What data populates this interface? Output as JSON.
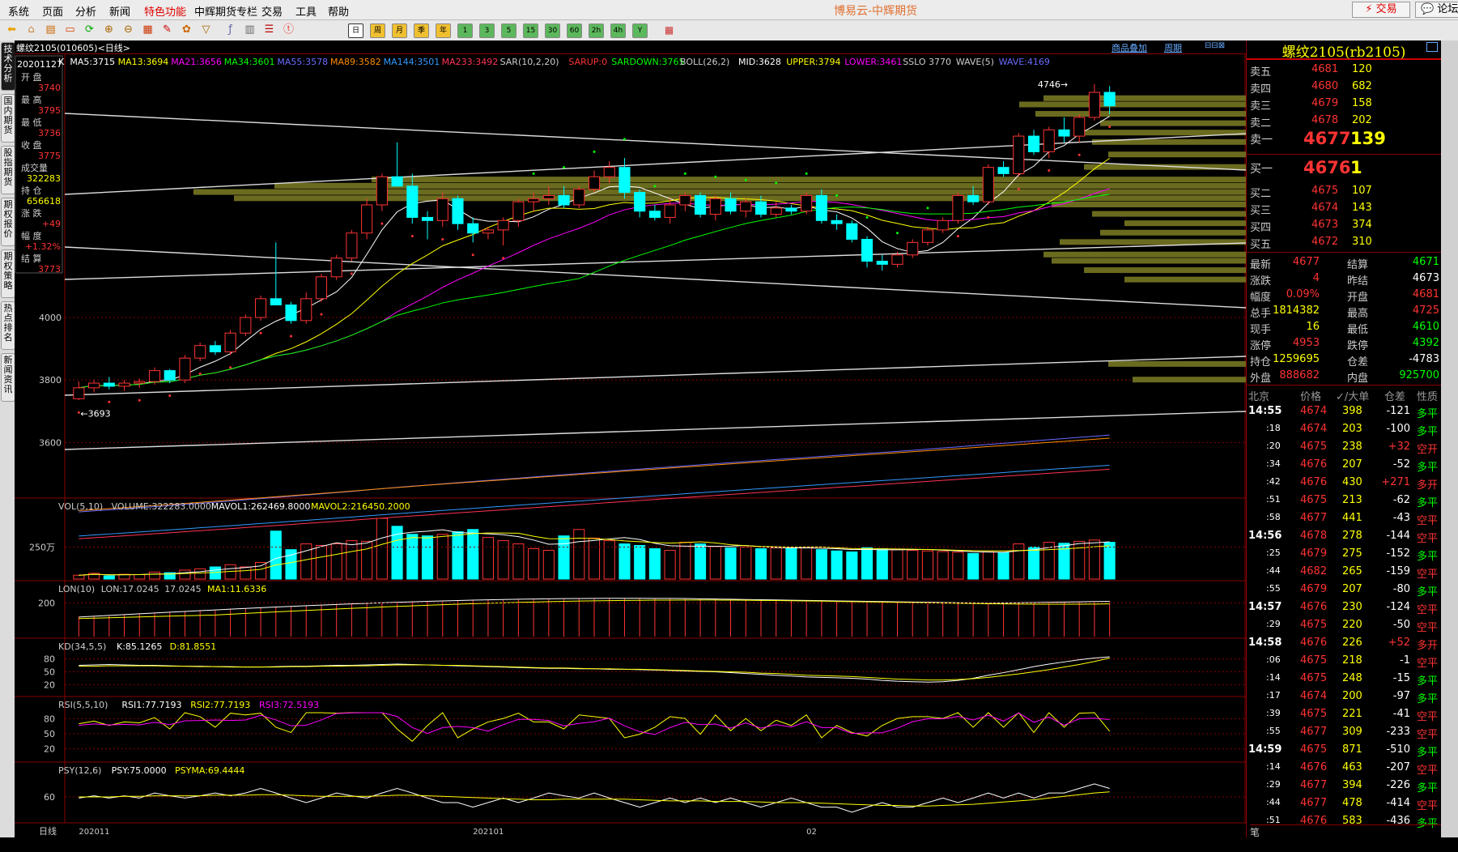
{
  "menu": [
    "系统",
    "页面",
    "分析",
    "新闻",
    "特色功能",
    "中辉期货专栏",
    "交易",
    "工具",
    "帮助"
  ],
  "menu_highlight_index": 4,
  "app_title": "博易云-中辉期货",
  "trade_button": "⚡ 交易",
  "forum_button": "💬 论坛",
  "toolbar": {
    "periods": [
      "日",
      "周",
      "月",
      "季",
      "年",
      "1",
      "3",
      "5",
      "15",
      "30",
      "60",
      "2h",
      "4h",
      "Y"
    ],
    "active_period": "日"
  },
  "left_tabs": [
    {
      "label": "技术分析",
      "active": true
    },
    {
      "label": "国内期货",
      "active": false
    },
    {
      "label": "股指期货",
      "active": false
    },
    {
      "label": "期权报价",
      "active": false
    },
    {
      "label": "期权策略",
      "active": false
    },
    {
      "label": "热点排名",
      "active": false
    },
    {
      "label": "新闻资讯",
      "active": false
    }
  ],
  "chart_header": {
    "symbol": "螺纹2105(010605)<日线>",
    "overlay": "商品叠加",
    "period": "周期"
  },
  "info_box": {
    "date": "20201127",
    "fields": [
      {
        "label": "开  盘",
        "value": "3740"
      },
      {
        "label": "最  高",
        "value": "3795"
      },
      {
        "label": "最  低",
        "value": "3736"
      },
      {
        "label": "收  盘",
        "value": "3775"
      },
      {
        "label": "成交量",
        "value": "322283"
      },
      {
        "label": "持  仓",
        "value": "656618"
      },
      {
        "label": "涨  跌",
        "value": "+49"
      },
      {
        "label": "幅  度",
        "value": "+1.32%"
      },
      {
        "label": "结  算",
        "value": "3773"
      }
    ]
  },
  "ma_legend": [
    {
      "text": "K",
      "color": "#ffffff"
    },
    {
      "text": "MA5:3715",
      "color": "#ffffff"
    },
    {
      "text": "MA13:3694",
      "color": "#ffff00"
    },
    {
      "text": "MA21:3656",
      "color": "#ff00ff"
    },
    {
      "text": "MA34:3601",
      "color": "#00ff00"
    },
    {
      "text": "MA55:3578",
      "color": "#6a6aff"
    },
    {
      "text": "MA89:3582",
      "color": "#ff8c00"
    },
    {
      "text": "MA144:3501",
      "color": "#3399ff"
    },
    {
      "text": "MA233:3492",
      "color": "#ff3355"
    },
    {
      "text": "SAR(10,2,20)",
      "color": "#cccccc"
    },
    {
      "text": "SARUP:0",
      "color": "#ff3333"
    },
    {
      "text": "SARDOWN:3765",
      "color": "#00ff00"
    },
    {
      "text": "BOLL(26,2)",
      "color": "#cccccc"
    },
    {
      "text": "MID:3628",
      "color": "#ffffff"
    },
    {
      "text": "UPPER:3794",
      "color": "#ffff00"
    },
    {
      "text": "LOWER:3461",
      "color": "#ff00ff"
    },
    {
      "text": "SSLO 3770",
      "color": "#cccccc"
    },
    {
      "text": "WAVE(5)",
      "color": "#cccccc"
    },
    {
      "text": "WAVE:4169",
      "color": "#6a6aff"
    }
  ],
  "indicators": {
    "vol": [
      {
        "text": "VOL(5,10)",
        "color": "#cccccc"
      },
      {
        "text": "VOLUME:322283.0000",
        "color": "#cccccc"
      },
      {
        "text": "MAVOL1:262469.8000",
        "color": "#ffffff"
      },
      {
        "text": "MAVOL2:216450.2000",
        "color": "#ffff00"
      }
    ],
    "lon": [
      {
        "text": "LON(10)",
        "color": "#cccccc"
      },
      {
        "text": "LON:17.0245",
        "color": "#cccccc"
      },
      {
        "text": "17.0245",
        "color": "#cccccc"
      },
      {
        "text": "MA1:11.6336",
        "color": "#ffff00"
      }
    ],
    "kd": [
      {
        "text": "KD(34,5,5)",
        "color": "#cccccc"
      },
      {
        "text": "K:85.1265",
        "color": "#ffffff"
      },
      {
        "text": "D:81.8551",
        "color": "#ffff00"
      }
    ],
    "rsi": [
      {
        "text": "RSI(5,5,10)",
        "color": "#cccccc"
      },
      {
        "text": "RSI1:77.7193",
        "color": "#ffffff"
      },
      {
        "text": "RSI2:77.7193",
        "color": "#ffff00"
      },
      {
        "text": "RSI3:72.5193",
        "color": "#ff00ff"
      }
    ],
    "psy": [
      {
        "text": "PSY(12,6)",
        "color": "#cccccc"
      },
      {
        "text": "PSY:75.0000",
        "color": "#ffffff"
      },
      {
        "text": "PSYMA:69.4444",
        "color": "#ffff00"
      }
    ]
  },
  "y_ticks": {
    "main": [
      "4000",
      "3800",
      "3600"
    ],
    "vol": [
      "250万"
    ],
    "lon": [
      "200"
    ],
    "kd": [
      "80",
      "50",
      "20"
    ],
    "rsi": [
      "80",
      "50",
      "20"
    ],
    "psy": [
      "60"
    ]
  },
  "annotations": {
    "high": "4746→",
    "low": "←3693"
  },
  "x_labels": [
    "日线",
    "202011",
    "202101",
    "02"
  ],
  "chart_data": {
    "type": "candlestick",
    "title": "螺纹2105(010605)<日线>",
    "period": "日线",
    "y_range": [
      3500,
      4790
    ],
    "candles": [
      [
        3740,
        3795,
        3736,
        3775
      ],
      [
        3775,
        3800,
        3760,
        3790
      ],
      [
        3790,
        3810,
        3770,
        3780
      ],
      [
        3780,
        3800,
        3765,
        3790
      ],
      [
        3790,
        3805,
        3775,
        3795
      ],
      [
        3795,
        3840,
        3785,
        3830
      ],
      [
        3830,
        3835,
        3790,
        3800
      ],
      [
        3800,
        3880,
        3790,
        3870
      ],
      [
        3870,
        3920,
        3860,
        3910
      ],
      [
        3910,
        3925,
        3880,
        3890
      ],
      [
        3890,
        3960,
        3880,
        3950
      ],
      [
        3950,
        4010,
        3940,
        4000
      ],
      [
        4000,
        4070,
        3990,
        4060
      ],
      [
        4060,
        4240,
        4040,
        4040
      ],
      [
        4040,
        4050,
        3980,
        3990
      ],
      [
        3990,
        4080,
        3980,
        4060
      ],
      [
        4060,
        4140,
        4050,
        4130
      ],
      [
        4130,
        4200,
        4120,
        4190
      ],
      [
        4190,
        4280,
        4180,
        4270
      ],
      [
        4270,
        4380,
        4250,
        4360
      ],
      [
        4360,
        4460,
        4340,
        4450
      ],
      [
        4450,
        4560,
        4420,
        4420
      ],
      [
        4420,
        4460,
        4300,
        4320
      ],
      [
        4320,
        4340,
        4250,
        4310
      ],
      [
        4310,
        4400,
        4290,
        4380
      ],
      [
        4380,
        4390,
        4280,
        4300
      ],
      [
        4300,
        4320,
        4240,
        4270
      ],
      [
        4270,
        4290,
        4250,
        4280
      ],
      [
        4280,
        4320,
        4230,
        4310
      ],
      [
        4310,
        4380,
        4290,
        4370
      ],
      [
        4370,
        4400,
        4340,
        4380
      ],
      [
        4380,
        4420,
        4360,
        4390
      ],
      [
        4390,
        4420,
        4350,
        4360
      ],
      [
        4360,
        4420,
        4350,
        4410
      ],
      [
        4410,
        4470,
        4400,
        4450
      ],
      [
        4450,
        4500,
        4430,
        4480
      ],
      [
        4480,
        4510,
        4380,
        4400
      ],
      [
        4400,
        4410,
        4320,
        4340
      ],
      [
        4340,
        4360,
        4310,
        4320
      ],
      [
        4320,
        4380,
        4300,
        4360
      ],
      [
        4360,
        4400,
        4340,
        4390
      ],
      [
        4390,
        4400,
        4320,
        4330
      ],
      [
        4330,
        4390,
        4310,
        4380
      ],
      [
        4380,
        4400,
        4330,
        4340
      ],
      [
        4340,
        4380,
        4320,
        4370
      ],
      [
        4370,
        4390,
        4320,
        4330
      ],
      [
        4330,
        4370,
        4320,
        4350
      ],
      [
        4350,
        4360,
        4330,
        4340
      ],
      [
        4340,
        4400,
        4330,
        4390
      ],
      [
        4390,
        4410,
        4300,
        4310
      ],
      [
        4310,
        4330,
        4280,
        4300
      ],
      [
        4300,
        4310,
        4240,
        4250
      ],
      [
        4250,
        4260,
        4160,
        4180
      ],
      [
        4180,
        4200,
        4150,
        4170
      ],
      [
        4170,
        4210,
        4160,
        4200
      ],
      [
        4200,
        4250,
        4190,
        4240
      ],
      [
        4240,
        4290,
        4230,
        4280
      ],
      [
        4280,
        4320,
        4270,
        4310
      ],
      [
        4310,
        4400,
        4300,
        4390
      ],
      [
        4390,
        4420,
        4360,
        4370
      ],
      [
        4370,
        4490,
        4360,
        4480
      ],
      [
        4480,
        4500,
        4450,
        4460
      ],
      [
        4460,
        4590,
        4450,
        4580
      ],
      [
        4580,
        4600,
        4520,
        4530
      ],
      [
        4530,
        4610,
        4510,
        4600
      ],
      [
        4600,
        4640,
        4560,
        4580
      ],
      [
        4580,
        4650,
        4560,
        4640
      ],
      [
        4640,
        4746,
        4630,
        4720
      ],
      [
        4720,
        4740,
        4650,
        4677
      ]
    ],
    "volume_wan": [
      12,
      18,
      10,
      15,
      14,
      22,
      20,
      28,
      32,
      38,
      45,
      38,
      52,
      150,
      92,
      110,
      105,
      110,
      120,
      118,
      190,
      165,
      140,
      135,
      140,
      148,
      155,
      130,
      120,
      110,
      95,
      90,
      135,
      155,
      128,
      120,
      110,
      105,
      95,
      90,
      115,
      110,
      102,
      98,
      100,
      95,
      98,
      96,
      100,
      92,
      88,
      85,
      98,
      95,
      92,
      90,
      88,
      86,
      84,
      80,
      85,
      83,
      110,
      100,
      115,
      112,
      118,
      122,
      115
    ],
    "kd_k": [
      65,
      66,
      67,
      66,
      65,
      65,
      64,
      63,
      63,
      62,
      62,
      61,
      61,
      62,
      63,
      63,
      64,
      65,
      65,
      66,
      67,
      68,
      67,
      66,
      65,
      64,
      63,
      62,
      61,
      60,
      59,
      58,
      58,
      57,
      57,
      56,
      56,
      55,
      54,
      53,
      52,
      51,
      50,
      48,
      46,
      44,
      42,
      40,
      38,
      37,
      36,
      35,
      33,
      30,
      28,
      27,
      26,
      27,
      30,
      35,
      42,
      48,
      55,
      62,
      68,
      73,
      78,
      82,
      85
    ],
    "kd_d": [
      63,
      63,
      64,
      64,
      64,
      64,
      63,
      63,
      62,
      62,
      61,
      61,
      61,
      61,
      62,
      62,
      63,
      63,
      64,
      64,
      65,
      66,
      66,
      66,
      65,
      65,
      64,
      63,
      62,
      61,
      60,
      59,
      59,
      58,
      57,
      57,
      56,
      56,
      55,
      54,
      53,
      52,
      51,
      50,
      49,
      47,
      46,
      44,
      42,
      41,
      40,
      39,
      37,
      35,
      33,
      32,
      31,
      31,
      32,
      34,
      37,
      41,
      45,
      50,
      55,
      61,
      67,
      74,
      82
    ],
    "psy": [
      58,
      62,
      58,
      62,
      58,
      67,
      62,
      58,
      62,
      67,
      62,
      67,
      75,
      67,
      58,
      50,
      58,
      67,
      62,
      58,
      67,
      75,
      67,
      58,
      50,
      50,
      42,
      50,
      58,
      50,
      58,
      67,
      62,
      58,
      67,
      58,
      50,
      42,
      50,
      58,
      50,
      58,
      50,
      58,
      50,
      42,
      50,
      58,
      50,
      42,
      42,
      33,
      42,
      50,
      42,
      42,
      50,
      58,
      50,
      58,
      67,
      58,
      67,
      58,
      67,
      67,
      75,
      83,
      75
    ],
    "psy_ma": [
      60,
      60,
      60,
      61,
      61,
      62,
      62,
      62,
      62,
      63,
      63,
      63,
      64,
      64,
      63,
      62,
      61,
      61,
      61,
      61,
      62,
      63,
      63,
      62,
      61,
      60,
      59,
      58,
      57,
      56,
      55,
      55,
      56,
      56,
      56,
      56,
      56,
      55,
      54,
      53,
      53,
      53,
      52,
      52,
      52,
      51,
      50,
      50,
      50,
      49,
      48,
      47,
      46,
      45,
      45,
      44,
      44,
      45,
      46,
      47,
      49,
      51,
      53,
      55,
      58,
      61,
      64,
      67,
      69
    ],
    "ma5_last": 3715,
    "ma13_last": 3694,
    "ma21_last": 3656,
    "ma34_last": 3601,
    "ma55_last": 3578,
    "ma89_last": 3582,
    "ma144_last": 3501,
    "ma233_last": 3492
  },
  "quote": {
    "title": "螺纹2105(rb2105)",
    "asks": [
      {
        "label": "卖五",
        "price": "4681",
        "vol": "120"
      },
      {
        "label": "卖四",
        "price": "4680",
        "vol": "682"
      },
      {
        "label": "卖三",
        "price": "4679",
        "vol": "158"
      },
      {
        "label": "卖二",
        "price": "4678",
        "vol": "202"
      },
      {
        "label": "卖一",
        "price": "4677",
        "vol": "139"
      }
    ],
    "bids": [
      {
        "label": "买一",
        "price": "4676",
        "vol": "1"
      },
      {
        "label": "买二",
        "price": "4675",
        "vol": "107"
      },
      {
        "label": "买三",
        "price": "4674",
        "vol": "143"
      },
      {
        "label": "买四",
        "price": "4673",
        "vol": "374"
      },
      {
        "label": "买五",
        "price": "4672",
        "vol": "310"
      }
    ],
    "stats": [
      {
        "l1": "最新",
        "v1": "4677",
        "c1": "#ff3333",
        "l2": "结算",
        "v2": "4671",
        "c2": "#00ff00"
      },
      {
        "l1": "涨跌",
        "v1": "4",
        "c1": "#ff3333",
        "l2": "昨结",
        "v2": "4673",
        "c2": "#ffffff"
      },
      {
        "l1": "幅度",
        "v1": "0.09%",
        "c1": "#ff3333",
        "l2": "开盘",
        "v2": "4681",
        "c2": "#ff3333"
      },
      {
        "l1": "总手",
        "v1": "1814382",
        "c1": "#ffff00",
        "l2": "最高",
        "v2": "4725",
        "c2": "#ff3333"
      },
      {
        "l1": "现手",
        "v1": "16",
        "c1": "#ffff00",
        "l2": "最低",
        "v2": "4610",
        "c2": "#00ff00"
      },
      {
        "l1": "涨停",
        "v1": "4953",
        "c1": "#ff3333",
        "l2": "跌停",
        "v2": "4392",
        "c2": "#00ff00"
      },
      {
        "l1": "持仓",
        "v1": "1259695",
        "c1": "#ffff00",
        "l2": "仓差",
        "v2": "-4783",
        "c2": "#ffffff"
      },
      {
        "l1": "外盘",
        "v1": "888682",
        "c1": "#ff3333",
        "l2": "内盘",
        "v2": "925700",
        "c2": "#00ff00"
      }
    ],
    "tick_header": [
      "北京",
      "价格",
      "✓/大单",
      "仓差",
      "性质"
    ],
    "ticks": [
      {
        "t": "14:55",
        "p": "4674",
        "v": "398",
        "d": "-121",
        "n": "多平",
        "big": true
      },
      {
        "t": ":18",
        "p": "4674",
        "v": "203",
        "d": "-100",
        "n": "多平"
      },
      {
        "t": ":20",
        "p": "4675",
        "v": "238",
        "d": "+32",
        "n": "空开"
      },
      {
        "t": ":34",
        "p": "4676",
        "v": "207",
        "d": "-52",
        "n": "多平"
      },
      {
        "t": ":42",
        "p": "4676",
        "v": "430",
        "d": "+271",
        "n": "多开"
      },
      {
        "t": ":51",
        "p": "4675",
        "v": "213",
        "d": "-62",
        "n": "多平"
      },
      {
        "t": ":58",
        "p": "4677",
        "v": "441",
        "d": "-43",
        "n": "空平"
      },
      {
        "t": "14:56",
        "p": "4678",
        "v": "278",
        "d": "-144",
        "n": "空平",
        "big": true
      },
      {
        "t": ":25",
        "p": "4679",
        "v": "275",
        "d": "-152",
        "n": "多平"
      },
      {
        "t": ":44",
        "p": "4682",
        "v": "265",
        "d": "-159",
        "n": "空平"
      },
      {
        "t": ":55",
        "p": "4679",
        "v": "207",
        "d": "-80",
        "n": "多平"
      },
      {
        "t": "14:57",
        "p": "4676",
        "v": "230",
        "d": "-124",
        "n": "空平",
        "big": true
      },
      {
        "t": ":29",
        "p": "4675",
        "v": "220",
        "d": "-50",
        "n": "空平"
      },
      {
        "t": "14:58",
        "p": "4676",
        "v": "226",
        "d": "+52",
        "n": "多开",
        "big": true
      },
      {
        "t": ":06",
        "p": "4675",
        "v": "218",
        "d": "-1",
        "n": "空平"
      },
      {
        "t": ":14",
        "p": "4675",
        "v": "248",
        "d": "-15",
        "n": "多平"
      },
      {
        "t": ":17",
        "p": "4674",
        "v": "200",
        "d": "-97",
        "n": "多平"
      },
      {
        "t": ":39",
        "p": "4675",
        "v": "221",
        "d": "-41",
        "n": "空平"
      },
      {
        "t": ":55",
        "p": "4677",
        "v": "309",
        "d": "-233",
        "n": "空平"
      },
      {
        "t": "14:59",
        "p": "4675",
        "v": "871",
        "d": "-510",
        "n": "多平",
        "big": true
      },
      {
        "t": ":14",
        "p": "4676",
        "v": "463",
        "d": "-207",
        "n": "空平"
      },
      {
        "t": ":29",
        "p": "4677",
        "v": "394",
        "d": "-226",
        "n": "多平"
      },
      {
        "t": ":44",
        "p": "4677",
        "v": "478",
        "d": "-414",
        "n": "空平"
      },
      {
        "t": ":51",
        "p": "4676",
        "v": "583",
        "d": "-436",
        "n": "多平"
      }
    ],
    "footer": "笔"
  }
}
